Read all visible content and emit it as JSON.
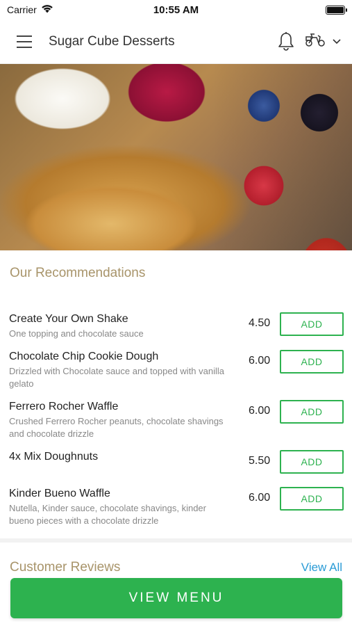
{
  "status_bar": {
    "carrier": "Carrier",
    "time": "10:55 AM"
  },
  "header": {
    "title": "Sugar Cube Desserts"
  },
  "recommendations": {
    "title": "Our Recommendations",
    "items": [
      {
        "name": "Create Your Own Shake",
        "description": "One topping and chocolate sauce",
        "price": "4.50",
        "add_label": "ADD"
      },
      {
        "name": "Chocolate Chip Cookie Dough",
        "description": "Drizzled with Chocolate sauce and topped with vanilla gelato",
        "price": "6.00",
        "add_label": "ADD"
      },
      {
        "name": "Ferrero Rocher Waffle",
        "description": "Crushed Ferrero Rocher peanuts, chocolate shavings and chocolate drizzle",
        "price": "6.00",
        "add_label": "ADD"
      },
      {
        "name": "4x Mix Doughnuts",
        "description": "",
        "price": "5.50",
        "add_label": "ADD"
      },
      {
        "name": "Kinder Bueno Waffle",
        "description": "Nutella, Kinder sauce, chocolate shavings, kinder bueno pieces with a chocolate drizzle",
        "price": "6.00",
        "add_label": "ADD"
      }
    ]
  },
  "reviews": {
    "title": "Customer Reviews",
    "view_all_label": "View All"
  },
  "footer": {
    "view_menu_label": "VIEW MENU"
  },
  "colors": {
    "accent_green": "#2db24f",
    "section_gold": "#a8946a",
    "link_blue": "#2a9bd6"
  },
  "icons": [
    "wifi-icon",
    "battery-icon",
    "hamburger-menu-icon",
    "bell-icon",
    "scooter-icon",
    "chevron-down-icon"
  ]
}
